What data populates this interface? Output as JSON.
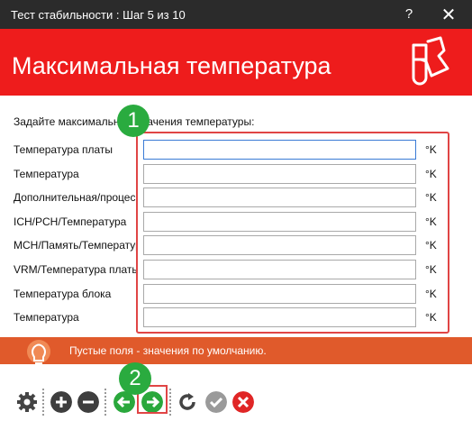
{
  "window": {
    "title": "Тест стабильности : Шаг 5 из 10",
    "help_label": "?",
    "close_label": "✕"
  },
  "banner": {
    "title": "Максимальная температура",
    "icon": "test-tube-flask-icon"
  },
  "prompt": "Задайте максимальные значения температуры:",
  "fields": [
    {
      "label": "Температура платы",
      "value": "",
      "unit": "°K"
    },
    {
      "label": "Температура",
      "value": "",
      "unit": "°K"
    },
    {
      "label": "Дополнительная/процессор",
      "value": "",
      "unit": "°K"
    },
    {
      "label": "ICH/PCH/Температура",
      "value": "",
      "unit": "°K"
    },
    {
      "label": "MCH/Память/Температура",
      "value": "",
      "unit": "°K"
    },
    {
      "label": "VRM/Температура платы",
      "value": "",
      "unit": "°K"
    },
    {
      "label": "Температура блока",
      "value": "",
      "unit": "°K"
    },
    {
      "label": "Температура",
      "value": "",
      "unit": "°K"
    }
  ],
  "annotations": {
    "badge_1": "1",
    "badge_2": "2"
  },
  "hint": "Пустые поля - значения по умолчанию.",
  "toolbar": {
    "buttons": [
      "gear-icon",
      "add-icon",
      "remove-icon",
      "back-arrow-icon",
      "next-arrow-icon",
      "refresh-icon",
      "check-icon",
      "cancel-icon"
    ]
  },
  "colors": {
    "banner": "#ee1c1c",
    "hint_bar": "#e05a2b",
    "titlebar": "#2b2b2b",
    "badge": "#2aab3f",
    "highlight": "#e04545"
  }
}
